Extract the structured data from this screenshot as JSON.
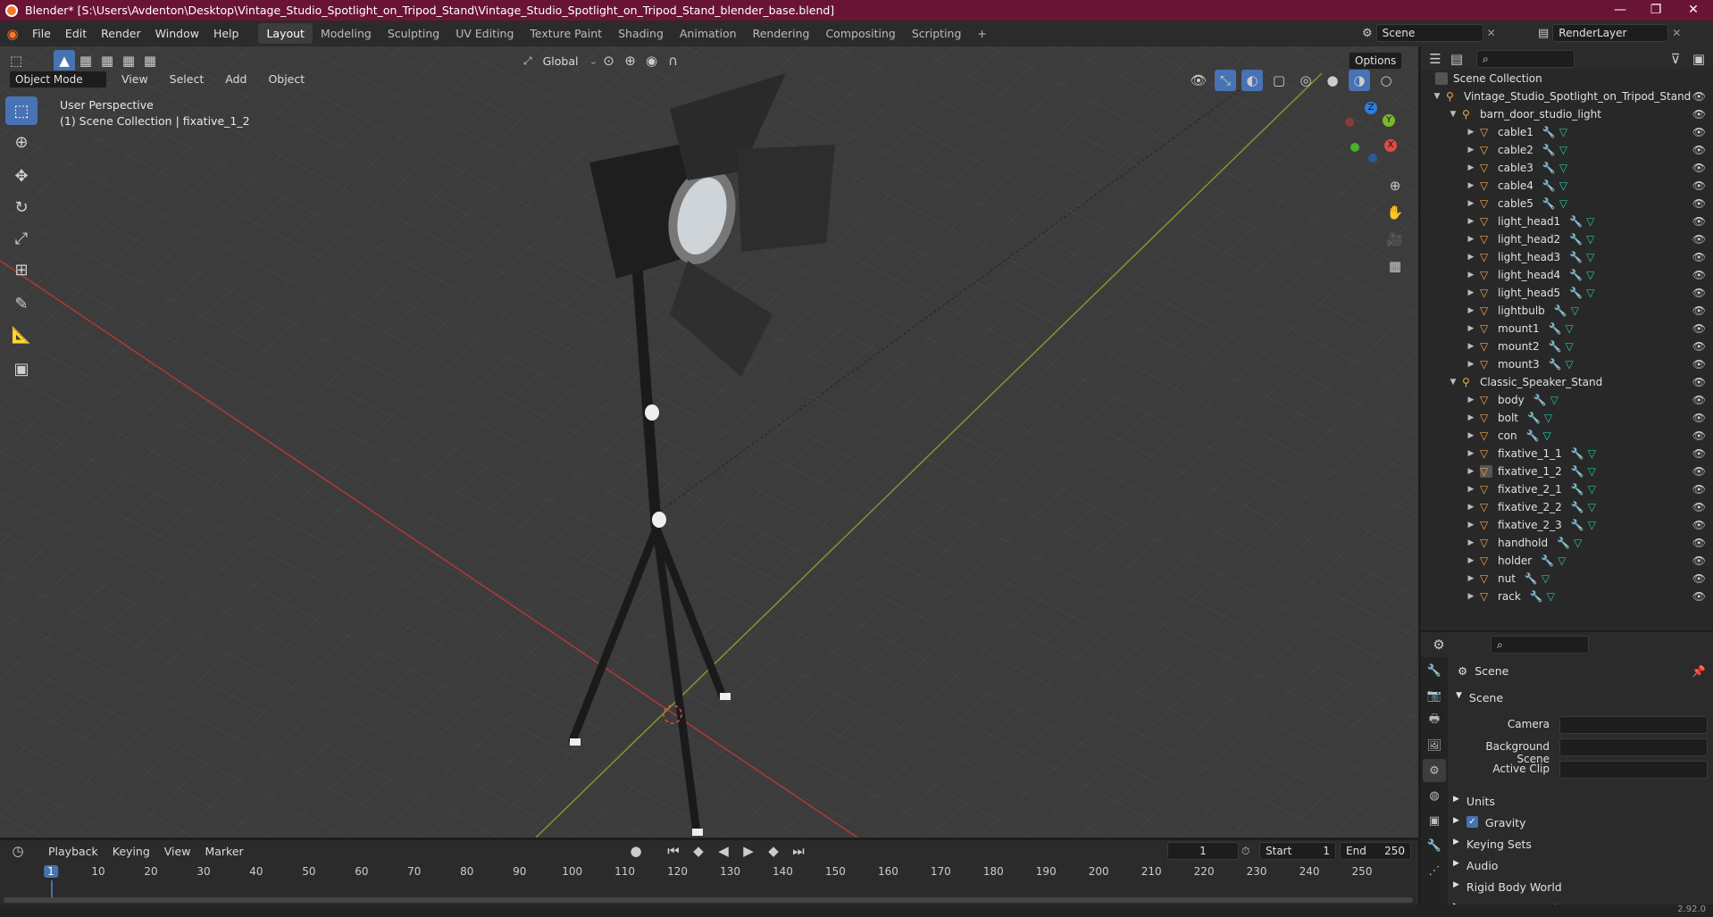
{
  "title_bar": {
    "title": "Blender* [S:\\Users\\Avdenton\\Desktop\\Vintage_Studio_Spotlight_on_Tripod_Stand\\Vintage_Studio_Spotlight_on_Tripod_Stand_blender_base.blend]",
    "minimize": "—",
    "maximize": "❐",
    "close": "✕"
  },
  "menu": {
    "items": [
      "File",
      "Edit",
      "Render",
      "Window",
      "Help"
    ],
    "workspaces": [
      "Layout",
      "Modeling",
      "Sculpting",
      "UV Editing",
      "Texture Paint",
      "Shading",
      "Animation",
      "Rendering",
      "Compositing",
      "Scripting"
    ],
    "active_workspace": "Layout",
    "add_workspace": "+",
    "scene": "Scene",
    "render_layer": "RenderLayer"
  },
  "viewport_header": {
    "mode": "Object Mode",
    "menus": [
      "View",
      "Select",
      "Add",
      "Object"
    ],
    "transform_orientation": "Global",
    "options": "Options"
  },
  "viewport": {
    "perspective": "User Perspective",
    "collection_info": "(1) Scene Collection | fixative_1_2",
    "gizmo": {
      "z": "Z",
      "y": "Y",
      "x": "X"
    }
  },
  "outliner": {
    "root": "Scene Collection",
    "collection": "Vintage_Studio_Spotlight_on_Tripod_Stand",
    "groups": [
      {
        "name": "barn_door_studio_light",
        "children": [
          "cable1",
          "cable2",
          "cable3",
          "cable4",
          "cable5",
          "light_head1",
          "light_head2",
          "light_head3",
          "light_head4",
          "light_head5",
          "lightbulb",
          "mount1",
          "mount2",
          "mount3"
        ]
      },
      {
        "name": "Classic_Speaker_Stand",
        "children": [
          "body",
          "bolt",
          "con",
          "fixative_1_1",
          "fixative_1_2",
          "fixative_2_1",
          "fixative_2_2",
          "fixative_2_3",
          "handhold",
          "holder",
          "nut",
          "rack"
        ]
      }
    ],
    "selected": "fixative_1_2"
  },
  "properties": {
    "context": "Scene",
    "panel": "Scene",
    "camera_label": "Camera",
    "background_scene_label": "Background Scene",
    "active_clip_label": "Active Clip",
    "sections": [
      "Units",
      "Gravity",
      "Keying Sets",
      "Audio",
      "Rigid Body World",
      "Custom Properties"
    ],
    "gravity_checked": true
  },
  "timeline": {
    "menus": [
      "Playback",
      "Keying",
      "View",
      "Marker"
    ],
    "current_frame": "1",
    "start_label": "Start",
    "start": "1",
    "end_label": "End",
    "end": "250",
    "ruler": [
      "1",
      "10",
      "20",
      "30",
      "40",
      "50",
      "60",
      "70",
      "80",
      "90",
      "100",
      "110",
      "120",
      "130",
      "140",
      "150",
      "160",
      "170",
      "180",
      "190",
      "200",
      "210",
      "220",
      "230",
      "240",
      "250"
    ]
  },
  "status": {
    "version": "2.92.0"
  }
}
